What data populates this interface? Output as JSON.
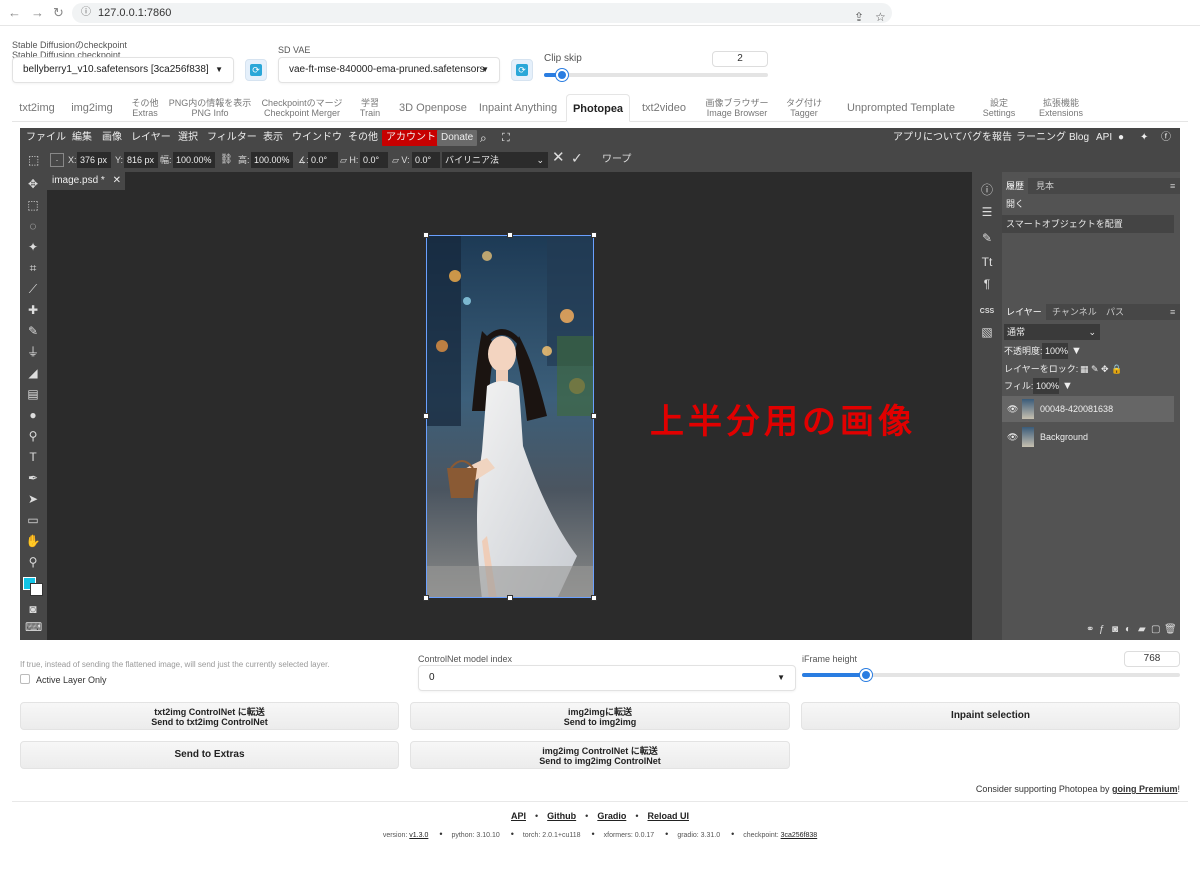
{
  "browser": {
    "url": "127.0.0.1:7860"
  },
  "settings": {
    "checkpoint_label_ja": "Stable Diffusionのcheckpoint",
    "checkpoint_label_en": "Stable Diffusion checkpoint",
    "checkpoint_value": "bellyberry1_v10.safetensors [3ca256f838]",
    "vae_label": "SD VAE",
    "vae_value": "vae-ft-mse-840000-ema-pruned.safetensors",
    "clipskip_label": "Clip skip",
    "clipskip_value": "2",
    "clipskip_fraction": 0.08
  },
  "tabs": [
    {
      "l1": "txt2img",
      "l2": ""
    },
    {
      "l1": "img2img",
      "l2": ""
    },
    {
      "l1": "その他",
      "l2": "Extras"
    },
    {
      "l1": "PNG内の情報を表示",
      "l2": "PNG Info"
    },
    {
      "l1": "Checkpointのマージ",
      "l2": "Checkpoint Merger"
    },
    {
      "l1": "学習",
      "l2": "Train"
    },
    {
      "l1": "3D Openpose",
      "l2": ""
    },
    {
      "l1": "Inpaint Anything",
      "l2": ""
    },
    {
      "l1": "Photopea",
      "l2": ""
    },
    {
      "l1": "txt2video",
      "l2": ""
    },
    {
      "l1": "画像ブラウザー",
      "l2": "Image Browser"
    },
    {
      "l1": "タグ付け",
      "l2": "Tagger"
    },
    {
      "l1": "Unprompted Template Editor",
      "l2": ""
    },
    {
      "l1": "設定",
      "l2": "Settings"
    },
    {
      "l1": "拡張機能",
      "l2": "Extensions"
    }
  ],
  "photopea": {
    "menu": [
      "ファイル",
      "編集",
      "画像",
      "レイヤー",
      "選択",
      "フィルター",
      "表示",
      "ウインドウ",
      "その他"
    ],
    "account": "アカウント",
    "donate": "Donate",
    "right_menu": [
      "アプリについて",
      "バグを報告",
      "ラーニング",
      "Blog",
      "API"
    ],
    "opts": {
      "x": "376 px",
      "y": "816 px",
      "w_label": "幅:",
      "w": "100.00%",
      "h_label": "高:",
      "h": "100.00%",
      "angle": "0.0°",
      "hskew": "0.0°",
      "vskew": "0.0°",
      "interp": "バイリニア法",
      "warp": "ワープ"
    },
    "doc_tab": "image.psd *",
    "overlay_text": "上半分用の画像",
    "history_tabs": [
      "履歴",
      "見本"
    ],
    "history": [
      "開く",
      "スマートオブジェクトを配置"
    ],
    "layer_tabs": [
      "レイヤー",
      "チャンネル",
      "パス"
    ],
    "blend": "通常",
    "opacity_label": "不透明度:",
    "opacity": "100%",
    "lock_label": "レイヤーをロック:",
    "fill_label": "フィル:",
    "fill": "100%",
    "layers": [
      "00048-420081638",
      "Background"
    ]
  },
  "bottom": {
    "hint": "If true, instead of sending the flattened image, will send just the currently selected layer.",
    "active_layer": "Active Layer Only",
    "cn_label": "ControlNet model index",
    "cn_value": "0",
    "iframe_label": "iFrame height",
    "iframe_value": "768",
    "iframe_fraction": 0.17,
    "btn_txt2img_ja": "txt2img ControlNet に転送",
    "btn_txt2img_en": "Send to txt2img ControlNet",
    "btn_img2img_ja": "img2imgに転送",
    "btn_img2img_en": "Send to img2img",
    "btn_inpaint": "Inpaint selection",
    "btn_extras": "Send to Extras",
    "btn_img2img_cn_ja": "img2img ControlNet に転送",
    "btn_img2img_cn_en": "Send to img2img ControlNet",
    "support_pre": "Consider supporting Photopea by ",
    "support_link": "going Premium",
    "support_post": "!"
  },
  "footer": {
    "links": [
      "API",
      "Github",
      "Gradio",
      "Reload UI"
    ],
    "version_label": "version: ",
    "version": "v1.3.0",
    "python": "python: 3.10.10",
    "torch": "torch: 2.0.1+cu118",
    "xformers": "xformers: 0.0.17",
    "gradio": "gradio: 3.31.0",
    "checkpoint_label": "checkpoint: ",
    "checkpoint": "3ca256f838"
  }
}
